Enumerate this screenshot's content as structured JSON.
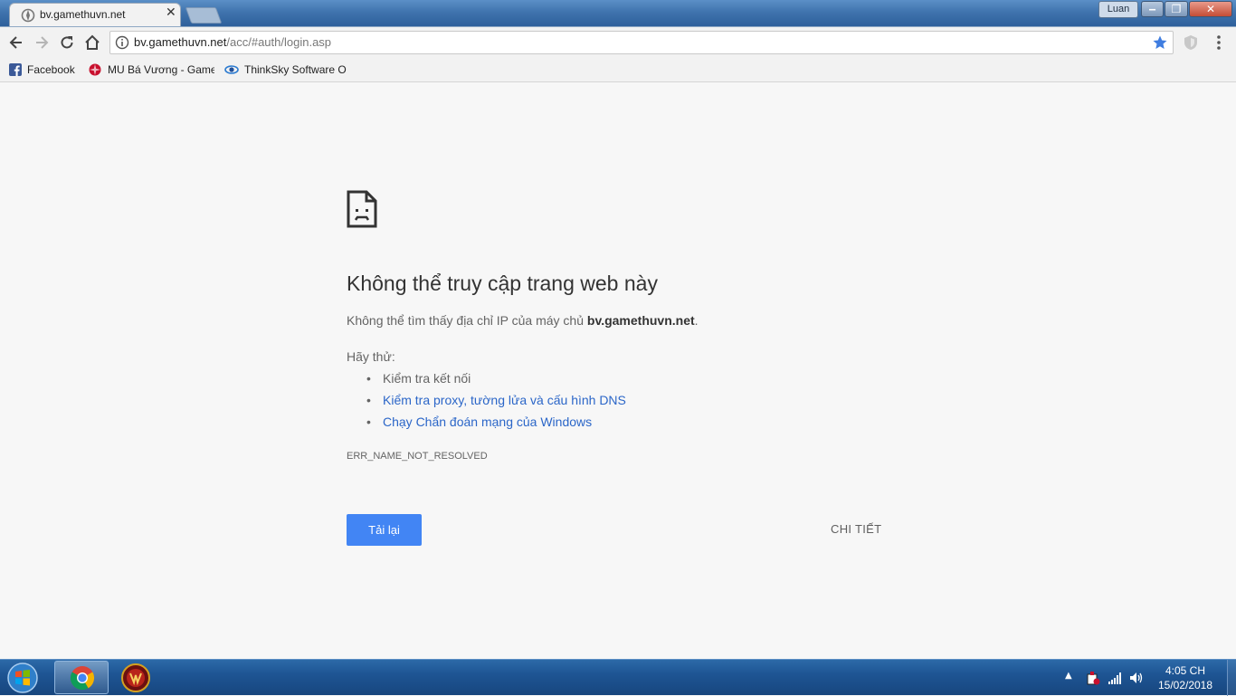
{
  "browser": {
    "tab": {
      "title": "bv.gamethuvn.net",
      "close_glyph": "✕"
    },
    "profile_name": "Luan",
    "window_controls": {
      "minimize": "‒",
      "maximize": "❐",
      "close": "✕"
    },
    "address": {
      "host": "bv.gamethuvn.net",
      "path": "/acc/#auth/login.asp"
    },
    "bookmarks": [
      {
        "label": "Facebook",
        "icon": "facebook-icon"
      },
      {
        "label": "MU Bá Vương - Game",
        "icon": "mu-game-icon"
      },
      {
        "label": "ThinkSky Software Of",
        "icon": "thinksky-icon"
      }
    ],
    "accent_color": "#4285f4"
  },
  "error_page": {
    "title": "Không thể truy cập trang web này",
    "desc_prefix": "Không thể tìm thấy địa chỉ IP của máy chủ ",
    "desc_host": "bv.gamethuvn.net",
    "desc_suffix": ".",
    "suggestions_label": "Hãy thử:",
    "suggestions": [
      "Kiểm tra kết nối",
      "Kiểm tra proxy, tường lửa và cấu hình DNS",
      "Chạy Chẩn đoán mạng của Windows"
    ],
    "error_code": "ERR_NAME_NOT_RESOLVED",
    "reload_label": "Tải lại",
    "details_label": "CHI TIẾT"
  },
  "taskbar": {
    "time": "4:05 CH",
    "date": "15/02/2018",
    "tray_arrow": "▲"
  }
}
